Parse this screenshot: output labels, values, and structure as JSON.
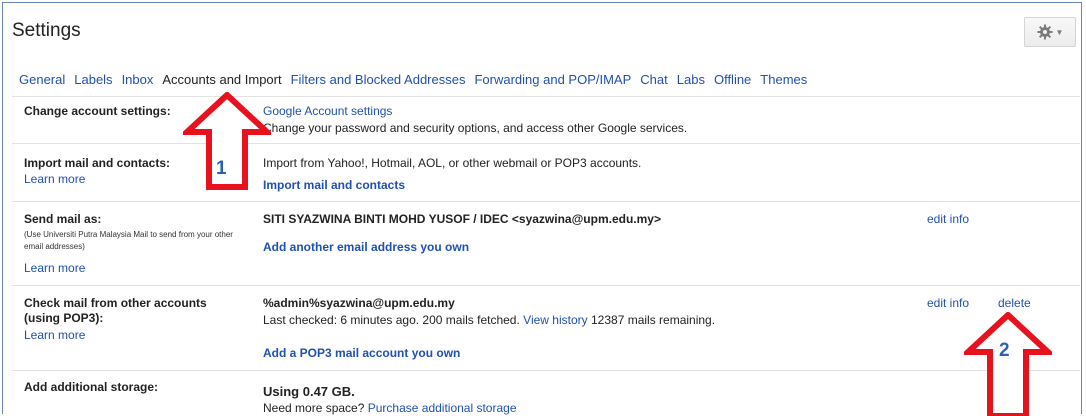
{
  "header": {
    "title": "Settings"
  },
  "tabs": [
    {
      "label": "General"
    },
    {
      "label": "Labels"
    },
    {
      "label": "Inbox"
    },
    {
      "label": "Accounts and Import",
      "active": true
    },
    {
      "label": "Filters and Blocked Addresses"
    },
    {
      "label": "Forwarding and POP/IMAP"
    },
    {
      "label": "Chat"
    },
    {
      "label": "Labs"
    },
    {
      "label": "Offline"
    },
    {
      "label": "Themes"
    }
  ],
  "rows": {
    "change_account": {
      "label": "Change account settings:",
      "link": "Google Account settings",
      "desc": "Change your password and security options, and access other Google services."
    },
    "import": {
      "label": "Import mail and contacts:",
      "learn_more": "Learn more",
      "desc": "Import from Yahoo!, Hotmail, AOL, or other webmail or POP3 accounts.",
      "action": "Import mail and contacts"
    },
    "send_as": {
      "label": "Send mail as:",
      "note": "(Use Universiti Putra Malaysia Mail to send from your other email addresses)",
      "learn_more": "Learn more",
      "identity": "SITI SYAZWINA BINTI MOHD YUSOF / IDEC <syazwina@upm.edu.my>",
      "edit": "edit info",
      "action": "Add another email address you own"
    },
    "check_mail": {
      "label_line1": "Check mail from other accounts",
      "label_line2": "(using POP3):",
      "learn_more": "Learn more",
      "account": "%admin%syazwina@upm.edu.my",
      "status_prefix": "Last checked: 6 minutes ago. 200 mails fetched.",
      "view_history": "View history",
      "remaining": "12387 mails remaining.",
      "edit": "edit info",
      "delete": "delete",
      "action": "Add a POP3 mail account you own"
    },
    "storage": {
      "label": "Add additional storage:",
      "usage": "Using 0.47 GB.",
      "prompt": "Need more space?",
      "purchase": "Purchase additional storage"
    }
  },
  "annotations": [
    {
      "number": "1",
      "color": "#e8121e"
    },
    {
      "number": "2",
      "color": "#e8121e"
    }
  ],
  "colors": {
    "link": "#1f51b2",
    "frame": "#6a86b6",
    "arrow": "#e8121e",
    "arrow_number": "#2b61b2"
  },
  "icons": {
    "settings_button": "gear-icon"
  }
}
